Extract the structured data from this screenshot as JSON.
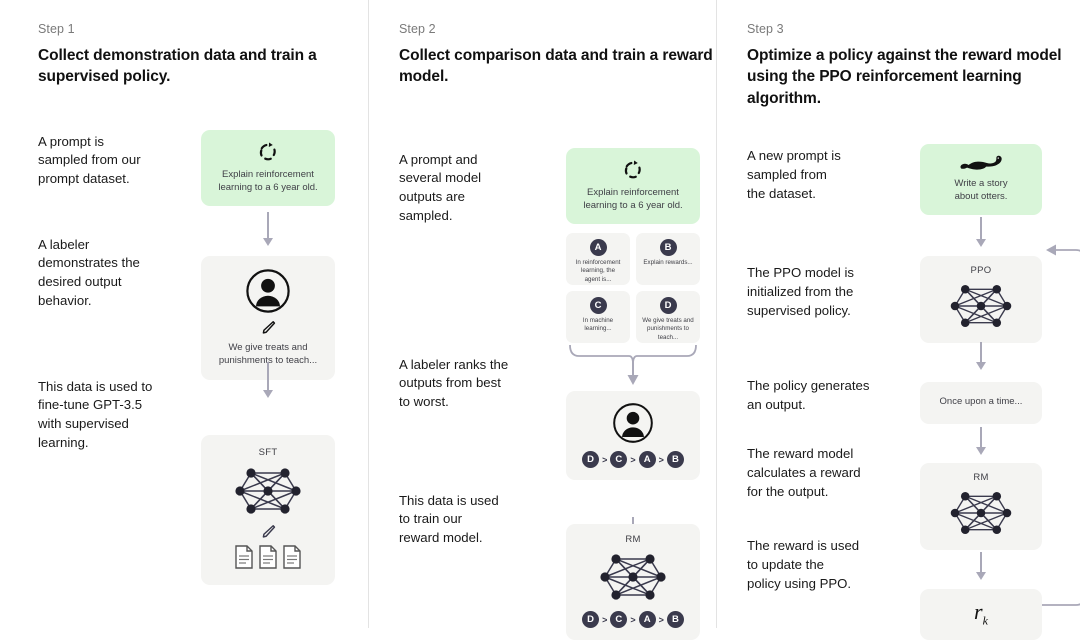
{
  "columns": [
    {
      "step_label": "Step 1",
      "title": "Collect demonstration data\nand train a supervised policy.",
      "descriptions": [
        "A prompt is\nsampled from our\nprompt dataset.",
        "A labeler\ndemonstrates the\ndesired output\nbehavior.",
        "This data is used to\nfine-tune GPT-3.5\nwith supervised\nlearning."
      ],
      "prompt_card": {
        "icon": "refresh-circle-icon",
        "text": "Explain reinforcement\nlearning to a 6 year old."
      },
      "labeler_card": {
        "person_icon": "person-circle-icon",
        "pencil_icon": "pencil-icon",
        "text": "We give treats and\npunishments to teach..."
      },
      "model_card": {
        "label": "SFT",
        "network_icon": "neural-network-icon",
        "pencil_icon": "pencil-icon",
        "docs_icon": "documents-icon"
      }
    },
    {
      "step_label": "Step 2",
      "title": "Collect comparison data and\ntrain a reward model.",
      "descriptions": [
        "A prompt and\nseveral model\noutputs are\nsampled.",
        "A labeler ranks the\noutputs from best\nto worst.",
        "This data is used\nto train our\nreward model."
      ],
      "prompt_card": {
        "icon": "refresh-circle-icon",
        "text": "Explain reinforcement\nlearning to a 6 year old."
      },
      "options": [
        {
          "badge": "A",
          "text": "In reinforcement\nlearning, the\nagent is..."
        },
        {
          "badge": "B",
          "text": "Explain rewards..."
        },
        {
          "badge": "C",
          "text": "In machine\nlearning..."
        },
        {
          "badge": "D",
          "text": "We give treats and\npunishments to\nteach..."
        }
      ],
      "ranking_card": {
        "person_icon": "person-circle-icon",
        "ranking": [
          "D",
          "C",
          "A",
          "B"
        ],
        "separator": ">"
      },
      "model_card": {
        "label": "RM",
        "network_icon": "neural-network-icon",
        "ranking": [
          "D",
          "C",
          "A",
          "B"
        ],
        "separator": ">"
      }
    },
    {
      "step_label": "Step 3",
      "title": "Optimize a policy against the\nreward model using the PPO\nreinforcement learning algorithm.",
      "descriptions": [
        "A new prompt is\nsampled from\nthe dataset.",
        "The PPO model is\ninitialized from the\nsupervised policy.",
        "The policy generates\nan output.",
        "The reward model\ncalculates a reward\nfor the output.",
        "The reward is used\nto update the\npolicy using PPO."
      ],
      "prompt_card": {
        "icon": "otter-icon",
        "text": "Write a story\nabout otters."
      },
      "ppo_card": {
        "label": "PPO",
        "network_icon": "neural-network-icon"
      },
      "output_card": {
        "text": "Once upon a time..."
      },
      "rm_card": {
        "label": "RM",
        "network_icon": "neural-network-icon"
      },
      "reward_card": {
        "symbol": "r",
        "subscript": "k"
      }
    }
  ],
  "colors": {
    "prompt_card_bg": "#d9f5d9",
    "card_bg": "#f4f4f2",
    "arrow": "#a9a8b8",
    "badge_bg": "#3a3a4d",
    "text": "#1a1a1a",
    "muted_text": "#7a7a7a"
  }
}
